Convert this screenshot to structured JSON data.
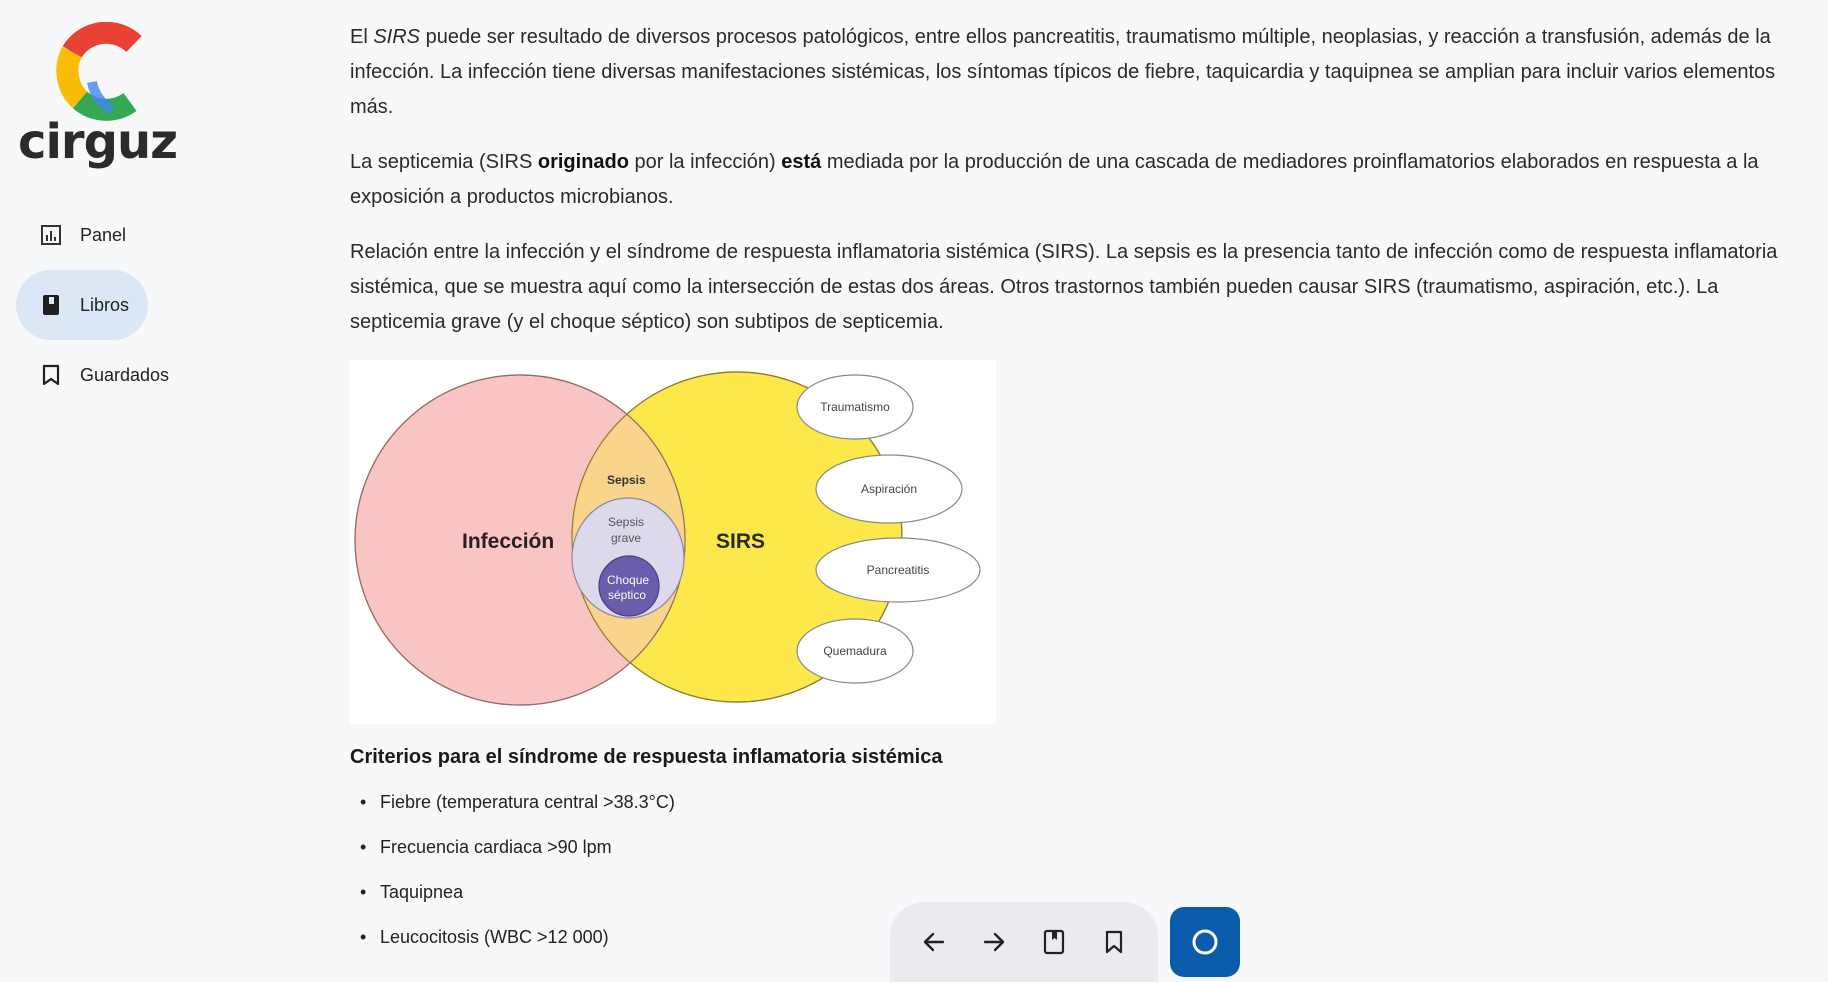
{
  "brand": {
    "logo_text": "cirguz"
  },
  "nav": {
    "items": [
      {
        "label": "Panel",
        "icon": "chart-icon",
        "active": false
      },
      {
        "label": "Libros",
        "icon": "book-icon",
        "active": true
      },
      {
        "label": "Guardados",
        "icon": "bookmark-icon",
        "active": false
      }
    ]
  },
  "content": {
    "p1": {
      "prefix": "El ",
      "italic": "SIRS",
      "rest": " puede ser resultado de diversos procesos patológicos, entre ellos pancreatitis, traumatismo múltiple, neoplasias, y reacción a transfusión, además de la infección. La infección tiene diversas manifestaciones sistémicas, los síntomas típicos de fiebre, taquicardia y taquipnea se amplian para incluir varios elementos más."
    },
    "p2": {
      "a": "La septicemia (SIRS ",
      "b1": "originado",
      "c": " por la infección) ",
      "b2": "está",
      "d": " mediada por la producción de una cascada de mediadores proinflamatorios elaborados en respuesta a la exposición a productos microbianos."
    },
    "p3": "Relación entre la infección y el síndrome de respuesta inflamatoria sistémica (SIRS). La sepsis es la presencia tanto de infección como de respuesta inflamatoria sistémica, que se muestra aquí como la intersección de estas dos áreas. Otros trastornos también pueden causar SIRS (traumatismo, aspiración, etc.). La septicemia grave (y el choque séptico) son subtipos de septicemia.",
    "diagram": {
      "infeccion": "Infección",
      "sirs": "SIRS",
      "sepsis": "Sepsis",
      "sepsis_grave_1": "Sepsis",
      "sepsis_grave_2": "grave",
      "choque_1": "Choque",
      "choque_2": "séptico",
      "causes": [
        "Traumatismo",
        "Aspiración",
        "Pancreatitis",
        "Quemadura"
      ],
      "colors": {
        "infeccion": "#f9c5c3",
        "sirs": "#fde84b",
        "sepsis": "#f8d58a",
        "grave": "#dcd9ea",
        "choque": "#6a5cac"
      }
    },
    "criteria_title": "Criterios para el síndrome de respuesta inflamatoria sistémica",
    "criteria": [
      "Fiebre (temperatura central >38.3°C)",
      "Frecuencia cardiaca >90 lpm",
      "Taquipnea",
      "Leucocitosis (WBC >12 000)"
    ]
  },
  "toolbar": {
    "buttons": [
      "arrow-left-icon",
      "arrow-right-icon",
      "book-icon",
      "bookmark-icon"
    ],
    "fab_icon": "circle-icon",
    "fab_color": "#0b5cab"
  }
}
